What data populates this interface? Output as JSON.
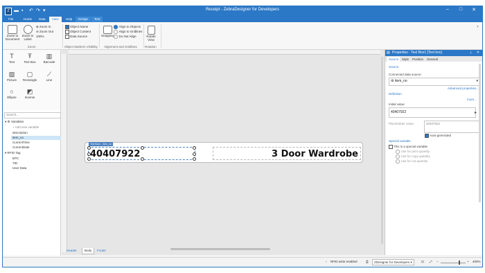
{
  "window": {
    "title": "Receipt - ZebraDesigner for Developers",
    "controls": [
      "minimize-icon",
      "maximize-icon",
      "close-icon"
    ]
  },
  "ribbon_tabs": [
    {
      "label": "File"
    },
    {
      "label": "Home"
    },
    {
      "label": "Data"
    },
    {
      "label": "View",
      "active": true
    },
    {
      "label": "Help"
    },
    {
      "label": "Design",
      "contextual": true
    },
    {
      "label": "Text",
      "contextual": true
    }
  ],
  "ribbon": {
    "zoom": {
      "zoom_to_document": "Zoom to Document",
      "zoom_to_label": "Zoom to Label",
      "zoom_in": "Zoom In",
      "zoom_out": "Zoom Out",
      "zoom_100": "100%",
      "group": "Zoom"
    },
    "visibility": {
      "object_name": "Object Name",
      "object_content": "Object Content",
      "data_source": "Data Source",
      "group": "Object Markers Visibility"
    },
    "alignment": {
      "snapping": "Snapping",
      "align_to_objects": "Align to Objects",
      "align_to_grid": "Align to Gridlines",
      "do_not_align": "Do Not Align",
      "group": "Alignment and Gridlines"
    },
    "rotation": {
      "rotate_view": "Rotate View",
      "group": "Rotation"
    }
  },
  "toolbox": [
    {
      "label": "Text",
      "icon": "text-tool-icon"
    },
    {
      "label": "Text Box",
      "icon": "text-box-tool-icon"
    },
    {
      "label": "Barcode",
      "icon": "barcode-tool-icon"
    },
    {
      "label": "Picture",
      "icon": "picture-tool-icon"
    },
    {
      "label": "Rectangle",
      "icon": "rectangle-tool-icon"
    },
    {
      "label": "Line",
      "icon": "line-tool-icon"
    },
    {
      "label": "Ellipse",
      "icon": "ellipse-tool-icon"
    },
    {
      "label": "Inverse",
      "icon": "inverse-tool-icon"
    }
  ],
  "variables": {
    "search_placeholder": "Search...",
    "root": "Variables",
    "add_new": "Add new variable",
    "items": [
      "description",
      "item_no",
      "CurrentTime",
      "CurrentDate"
    ],
    "selected": "item_no",
    "rfid": "RFID Tag",
    "rfid_items": [
      "EPC",
      "TID",
      "User Data"
    ]
  },
  "label": {
    "field1_caption": "Text Box1 - item_no",
    "field1_value": "40407922",
    "field2_value": "3 Door Wardrobe"
  },
  "document_tabs": [
    {
      "label": "Header"
    },
    {
      "label": "Body",
      "active": true
    },
    {
      "label": "Footer"
    }
  ],
  "properties": {
    "title": "Properties - Text Box1 [Text box]",
    "tabs": [
      "Source",
      "Style",
      "Position",
      "General"
    ],
    "active_tab": "Source",
    "source_heading": "Source",
    "connected_label": "Connected data source:",
    "connected_value": "item_no",
    "advanced_link": "Advanced properties...",
    "definition": "Definition",
    "more": "more...",
    "initial_label": "Initial value:",
    "initial_value": "40407922",
    "placeholder_label": "Placeholder value:",
    "placeholder_value": "40407922",
    "auto_generated": "Auto-generated",
    "special_heading": "Special variable",
    "special_check": "This is a special variable",
    "special_options": [
      "Use for print quantity",
      "Use for copy quantity",
      "Use for cut quantity"
    ]
  },
  "status": {
    "rfid": "RFID write enabled",
    "printer": "ZDesigner for Developers",
    "zoom": "400%"
  }
}
